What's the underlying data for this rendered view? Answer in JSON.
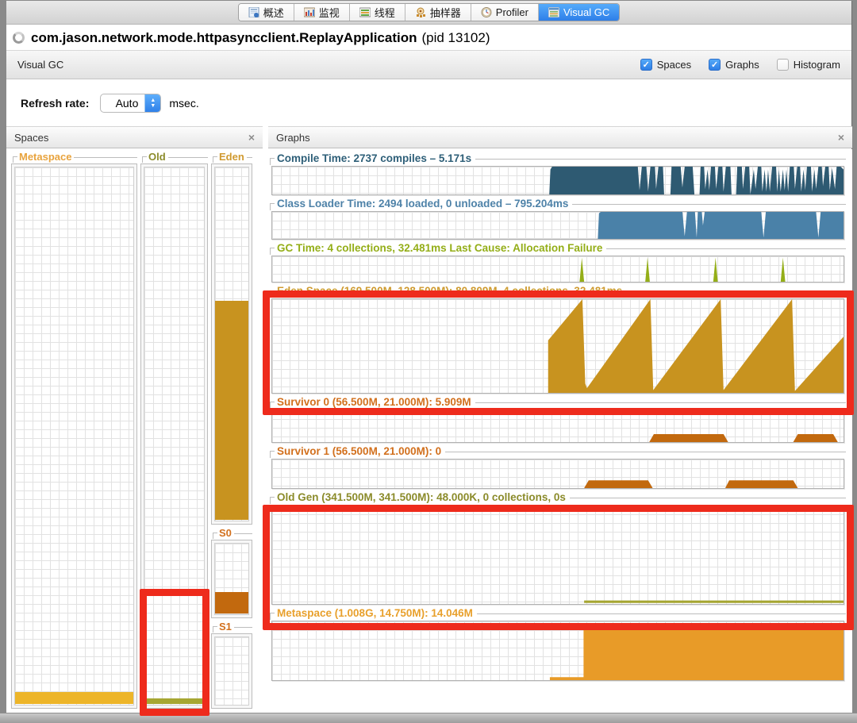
{
  "tabs": {
    "active": "Visual GC",
    "items": [
      {
        "label": "概述",
        "icon": "overview-icon"
      },
      {
        "label": "监视",
        "icon": "monitor-icon"
      },
      {
        "label": "线程",
        "icon": "threads-icon"
      },
      {
        "label": "抽样器",
        "icon": "sampler-icon"
      },
      {
        "label": "Profiler",
        "icon": "profiler-icon"
      },
      {
        "label": "Visual GC",
        "icon": "visualgc-icon"
      }
    ]
  },
  "title": {
    "app": "com.jason.network.mode.httpasyncclient.ReplayApplication",
    "pid": "(pid 13102)"
  },
  "toolbar": {
    "label": "Visual GC",
    "checkboxes": [
      {
        "label": "Spaces",
        "checked": true
      },
      {
        "label": "Graphs",
        "checked": true
      },
      {
        "label": "Histogram",
        "checked": false
      }
    ]
  },
  "refresh": {
    "label": "Refresh rate:",
    "value": "Auto",
    "unit": "msec."
  },
  "spaces_panel": {
    "title": "Spaces",
    "close_icon": "×",
    "groups": [
      {
        "label": "Metaspace",
        "label_color": "#E8A33D",
        "fill_color": "#EDB529",
        "fill_percent": 2.2
      },
      {
        "label": "Old",
        "label_color": "#8B8B2A",
        "fill_color": "#A6A632",
        "fill_percent": 1.0
      },
      {
        "label": "Eden",
        "label_color": "#D09A30",
        "fill_color": "#C8931F",
        "fill_percent": 62
      },
      {
        "label": "S0",
        "label_color": "#D2701D",
        "fill_color": "#C2690E",
        "fill_percent": 30
      },
      {
        "label": "S1",
        "label_color": "#D2701D",
        "fill_color": "#C2690E",
        "fill_percent": 0
      }
    ]
  },
  "graphs_panel": {
    "title": "Graphs",
    "close_icon": "×",
    "items": [
      {
        "title": "Compile Time: 2737 compiles – 5.171s",
        "title_color": "#2E5F78",
        "color": "#2E5A72",
        "fills": [
          [
            [
              0.485,
              0
            ],
            [
              0.487,
              0.9
            ],
            [
              0.49,
              1
            ],
            [
              0.64,
              1
            ],
            [
              0.643,
              0.15
            ],
            [
              0.647,
              1
            ],
            [
              0.655,
              1
            ],
            [
              0.658,
              0.1
            ],
            [
              0.662,
              1
            ],
            [
              0.67,
              1
            ],
            [
              0.672,
              0.2
            ],
            [
              0.676,
              1
            ],
            [
              0.684,
              1
            ],
            [
              0.686,
              0
            ],
            [
              0.697,
              0
            ],
            [
              0.699,
              1
            ],
            [
              0.715,
              1
            ],
            [
              0.718,
              0.25
            ],
            [
              0.722,
              1
            ],
            [
              0.736,
              1
            ],
            [
              0.739,
              0
            ],
            [
              0.748,
              0
            ],
            [
              0.75,
              1
            ],
            [
              0.756,
              1
            ],
            [
              0.758,
              0.2
            ],
            [
              0.762,
              0.9
            ],
            [
              0.765,
              0.15
            ],
            [
              0.768,
              1
            ],
            [
              0.775,
              1
            ],
            [
              0.777,
              0.2
            ],
            [
              0.781,
              1
            ],
            [
              0.788,
              1
            ],
            [
              0.79,
              0.1
            ],
            [
              0.794,
              1
            ],
            [
              0.802,
              1
            ],
            [
              0.804,
              0
            ],
            [
              0.812,
              0
            ],
            [
              0.814,
              1
            ],
            [
              0.822,
              1
            ],
            [
              0.824,
              0.2
            ],
            [
              0.828,
              1
            ],
            [
              0.835,
              1
            ],
            [
              0.837,
              0
            ],
            [
              0.843,
              0.9
            ],
            [
              0.846,
              0.2
            ],
            [
              0.85,
              1
            ],
            [
              0.856,
              1
            ],
            [
              0.858,
              0.1
            ],
            [
              0.862,
              0.9
            ],
            [
              0.865,
              0.1
            ],
            [
              0.868,
              0.9
            ],
            [
              0.871,
              0.1
            ],
            [
              0.875,
              1
            ],
            [
              0.882,
              1
            ],
            [
              0.884,
              0.1
            ],
            [
              0.887,
              0.9
            ],
            [
              0.89,
              0.1
            ],
            [
              0.894,
              0.9
            ],
            [
              0.897,
              0.15
            ],
            [
              0.9,
              0.9
            ],
            [
              0.903,
              0.1
            ],
            [
              0.906,
              1
            ],
            [
              0.913,
              1
            ],
            [
              0.915,
              0.2
            ],
            [
              0.919,
              1
            ],
            [
              0.924,
              1
            ],
            [
              0.926,
              0.1
            ],
            [
              0.93,
              0.9
            ],
            [
              0.933,
              0.15
            ],
            [
              0.936,
              1
            ],
            [
              0.943,
              1
            ],
            [
              0.945,
              0.1
            ],
            [
              0.949,
              0.9
            ],
            [
              0.952,
              0.2
            ],
            [
              0.956,
              1
            ],
            [
              0.962,
              1
            ],
            [
              0.964,
              0.3
            ],
            [
              0.968,
              1
            ],
            [
              0.974,
              1
            ],
            [
              0.976,
              0.15
            ],
            [
              0.98,
              0.95
            ],
            [
              0.985,
              0.2
            ],
            [
              0.988,
              1
            ],
            [
              0.995,
              1
            ],
            [
              1,
              0.9
            ],
            [
              1,
              0
            ]
          ]
        ]
      },
      {
        "title": "Class Loader Time: 2494 loaded, 0 unloaded – 795.204ms",
        "title_color": "#4E82A8",
        "color": "#4A81A8",
        "fills": [
          [
            [
              0.57,
              0
            ],
            [
              0.572,
              0.95
            ],
            [
              0.575,
              1
            ],
            [
              0.718,
              1
            ],
            [
              0.722,
              0.1
            ],
            [
              0.726,
              1
            ],
            [
              0.74,
              1
            ],
            [
              0.743,
              0.05
            ],
            [
              0.745,
              1
            ],
            [
              0.752,
              1
            ],
            [
              0.754,
              0.5
            ],
            [
              0.757,
              1
            ],
            [
              0.856,
              1
            ],
            [
              0.86,
              0.05
            ],
            [
              0.864,
              1
            ],
            [
              0.952,
              1
            ],
            [
              0.956,
              0.05
            ],
            [
              0.96,
              1
            ],
            [
              1,
              1
            ],
            [
              1,
              0
            ]
          ]
        ]
      },
      {
        "title": "GC Time: 4 collections, 32.481ms Last Cause: Allocation Failure",
        "title_color": "#94AE18",
        "color": "#94AE18",
        "fills": [
          [
            [
              0.538,
              0
            ],
            [
              0.542,
              0.95
            ],
            [
              0.546,
              0
            ]
          ],
          [
            [
              0.653,
              0
            ],
            [
              0.657,
              0.95
            ],
            [
              0.661,
              0
            ]
          ],
          [
            [
              0.772,
              0
            ],
            [
              0.776,
              0.95
            ],
            [
              0.78,
              0
            ]
          ],
          [
            [
              0.89,
              0
            ],
            [
              0.894,
              0.95
            ],
            [
              0.898,
              0
            ]
          ]
        ]
      },
      {
        "title": "Eden Space (169.500M, 128.500M): 80.809M, 4 collections, 32.481ms",
        "title_color": "#D09A30",
        "color": "#C8931F",
        "fills": [
          [
            [
              0.483,
              0
            ],
            [
              0.483,
              0.56
            ],
            [
              0.543,
              1
            ],
            [
              0.548,
              0.1
            ],
            [
              0.551,
              0.05
            ],
            [
              0.662,
              1
            ],
            [
              0.667,
              0.03
            ],
            [
              0.785,
              1
            ],
            [
              0.79,
              0.03
            ],
            [
              0.91,
              1
            ],
            [
              0.915,
              0.02
            ],
            [
              1,
              0.6
            ],
            [
              1,
              0
            ]
          ]
        ]
      },
      {
        "title": "Survivor 0 (56.500M, 21.000M): 5.909M",
        "title_color": "#D2701D",
        "color": "#C2690E",
        "fills": [
          [
            [
              0.66,
              0
            ],
            [
              0.668,
              0.25
            ],
            [
              0.79,
              0.25
            ],
            [
              0.798,
              0
            ]
          ],
          [
            [
              0.912,
              0
            ],
            [
              0.92,
              0.25
            ],
            [
              0.982,
              0.25
            ],
            [
              0.99,
              0
            ]
          ]
        ]
      },
      {
        "title": "Survivor 1 (56.500M, 21.000M): 0",
        "title_color": "#D2701D",
        "color": "#C2690E",
        "fills": [
          [
            [
              0.546,
              0
            ],
            [
              0.554,
              0.27
            ],
            [
              0.658,
              0.27
            ],
            [
              0.666,
              0
            ]
          ],
          [
            [
              0.793,
              0
            ],
            [
              0.8,
              0.27
            ],
            [
              0.912,
              0.27
            ],
            [
              0.92,
              0
            ]
          ]
        ]
      },
      {
        "title": "Old Gen (341.500M, 341.500M): 48.000K, 0 collections, 0s",
        "title_color": "#8B8B2A",
        "color": "#A6A632",
        "fills": [
          [
            [
              0.546,
              0.01
            ],
            [
              0.546,
              0.035
            ],
            [
              1,
              0.035
            ],
            [
              1,
              0.01
            ]
          ]
        ]
      },
      {
        "title": "Metaspace (1.008G, 14.750M): 14.046M",
        "title_color": "#E8A02C",
        "color": "#E89B28",
        "fills": [
          [
            [
              0.486,
              0
            ],
            [
              0.486,
              0.05
            ],
            [
              0.545,
              0.05
            ],
            [
              0.545,
              0.9
            ],
            [
              0.665,
              0.9
            ],
            [
              0.665,
              0.96
            ],
            [
              1,
              0.96
            ],
            [
              1,
              0
            ]
          ]
        ]
      }
    ]
  }
}
